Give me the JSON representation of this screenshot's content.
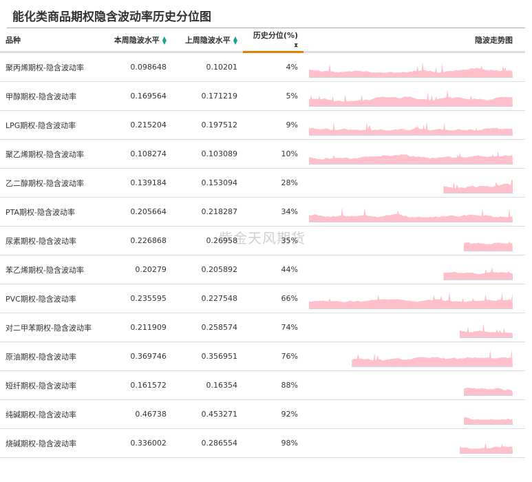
{
  "title": "能化类商品期权隐含波动率历史分位图",
  "watermark": "紫金天风期货",
  "headers": {
    "name": "品种",
    "this_week": "本周隐波水平",
    "last_week": "上周隐波水平",
    "percentile": "历史分位(%)",
    "trend": "隐波走势图"
  },
  "colors": {
    "spark": "#ffc0cb",
    "accent": "#e67e00",
    "sort": "#1aa38e"
  },
  "rows": [
    {
      "name": "聚丙烯期权-隐含波动率",
      "this_week": "0.098648",
      "last_week": "0.10201",
      "percentile": "4%",
      "history_start": 0
    },
    {
      "name": "甲醇期权-隐含波动率",
      "this_week": "0.169564",
      "last_week": "0.171219",
      "percentile": "5%",
      "history_start": 0
    },
    {
      "name": "LPG期权-隐含波动率",
      "this_week": "0.215204",
      "last_week": "0.197512",
      "percentile": "9%",
      "history_start": 0
    },
    {
      "name": "聚乙烯期权-隐含波动率",
      "this_week": "0.108274",
      "last_week": "0.103089",
      "percentile": "10%",
      "history_start": 0
    },
    {
      "name": "乙二醇期权-隐含波动率",
      "this_week": "0.139184",
      "last_week": "0.153094",
      "percentile": "28%",
      "history_start": 0.66
    },
    {
      "name": "PTA期权-隐含波动率",
      "this_week": "0.205664",
      "last_week": "0.218287",
      "percentile": "34%",
      "history_start": 0
    },
    {
      "name": "尿素期权-隐含波动率",
      "this_week": "0.226868",
      "last_week": "0.26958",
      "percentile": "35%",
      "history_start": 0.76
    },
    {
      "name": "苯乙烯期权-隐含波动率",
      "this_week": "0.20279",
      "last_week": "0.205892",
      "percentile": "44%",
      "history_start": 0.66
    },
    {
      "name": "PVC期权-隐含波动率",
      "this_week": "0.235595",
      "last_week": "0.227548",
      "percentile": "66%",
      "history_start": 0
    },
    {
      "name": "对二甲苯期权-隐含波动率",
      "this_week": "0.211909",
      "last_week": "0.258574",
      "percentile": "74%",
      "history_start": 0.74
    },
    {
      "name": "原油期权-隐含波动率",
      "this_week": "0.369746",
      "last_week": "0.356951",
      "percentile": "76%",
      "history_start": 0.21
    },
    {
      "name": "短纤期权-隐含波动率",
      "this_week": "0.161572",
      "last_week": "0.16354",
      "percentile": "88%",
      "history_start": 0.76
    },
    {
      "name": "纯碱期权-隐含波动率",
      "this_week": "0.46738",
      "last_week": "0.453271",
      "percentile": "92%",
      "history_start": 0.76
    },
    {
      "name": "烧碱期权-隐含波动率",
      "this_week": "0.336002",
      "last_week": "0.286554",
      "percentile": "98%",
      "history_start": 0.74
    }
  ]
}
